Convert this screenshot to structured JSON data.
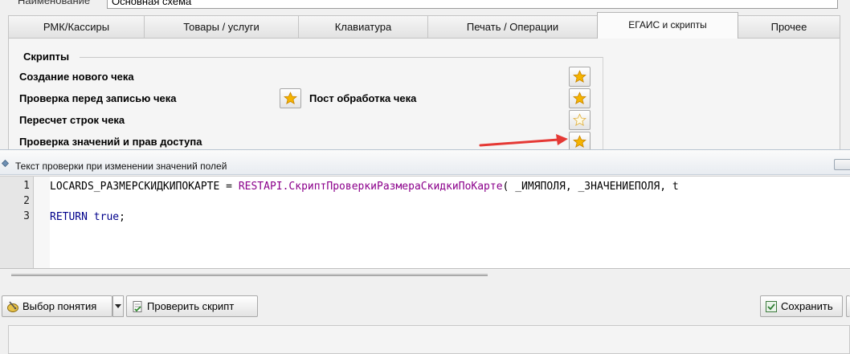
{
  "top_window": {
    "name_label": "Наименование",
    "name_value": "Основная схема",
    "tabs": [
      {
        "label": "РМК/Кассиры",
        "active": false
      },
      {
        "label": "Товары / услуги",
        "active": false
      },
      {
        "label": "Клавиатура",
        "active": false
      },
      {
        "label": "Печать / Операции",
        "active": false
      },
      {
        "label": "ЕГАИС и скрипты",
        "active": true
      },
      {
        "label": "Прочее",
        "active": false
      }
    ],
    "scripts_group": {
      "legend": "Скрипты",
      "rows": [
        {
          "label": "Создание нового чека",
          "star": "star-filled-icon"
        },
        {
          "label": "Проверка перед записью чека",
          "star": "star-filled-icon"
        },
        {
          "label": "Пост обработка чека",
          "star": "star-filled-icon"
        },
        {
          "label": "Пересчет строк чека",
          "star": "star-outline-icon"
        },
        {
          "label": "Проверка значений и прав доступа",
          "star": "star-filled-icon"
        }
      ]
    }
  },
  "editor_window": {
    "title": "Текст проверки при изменении значений полей",
    "line_numbers": [
      "1",
      "2",
      "3"
    ],
    "code": {
      "line1": {
        "var": "LOCARDS_РАЗМЕРСКИДКИПОКАРТЕ",
        "op": " = ",
        "api": "RESTAPI.СкриптПроверкиРазмераСкидкиПоКарте",
        "args": "( _ИМЯПОЛЯ, _ЗНАЧЕНИЕПОЛЯ, t"
      },
      "line3": {
        "kw1": "RETURN",
        "kw2": "true",
        "end": ";"
      }
    },
    "toolbar": {
      "concept_button": "Выбор понятия",
      "check_button": "Проверить скрипт",
      "save_button": "Сохранить"
    }
  },
  "colors": {
    "api_call": "#8b008b",
    "keyword": "#00008b",
    "star": "#f5b400",
    "arrow": "#e53935"
  }
}
